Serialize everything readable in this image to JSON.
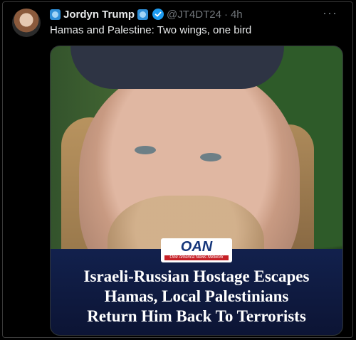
{
  "tweet": {
    "author_name": "Jordyn Trump",
    "handle": "@JT4DT24",
    "separator": "·",
    "time": "4h",
    "more": "···",
    "text": "Hamas and Palestine: Two wings, one bird"
  },
  "media": {
    "logo": "OAN",
    "logo_sub": "One America News Network",
    "headline_lines": [
      "Israeli-Russian Hostage Escapes",
      "Hamas, Local Palestinians",
      "Return Him Back To Terrorists"
    ]
  },
  "icons": {
    "name_emoji_left": "square-flag-icon",
    "name_emoji_right": "square-flag-icon",
    "verified": "verified-badge-icon",
    "more": "more-options-icon"
  },
  "colors": {
    "background": "#000000",
    "verified": "#1d9bf0",
    "muted_text": "#71767b",
    "headline_bg": "#12214d"
  }
}
